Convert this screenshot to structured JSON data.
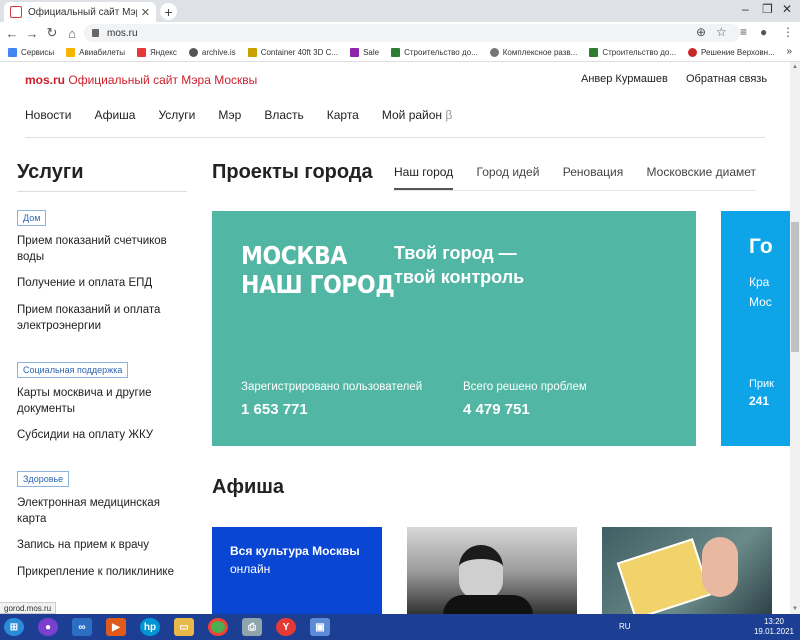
{
  "browser": {
    "tab_title": "Официальный сайт Мэра Моск",
    "tab_close": "✕",
    "new_tab": "+",
    "url": "mos.ru",
    "bookmarks": [
      {
        "label": "Сервисы",
        "color": "#4285f4"
      },
      {
        "label": "Авиабилеты",
        "color": "#f4b400"
      },
      {
        "label": "Яндекс",
        "color": "#e53935"
      },
      {
        "label": "archive.is",
        "color": "#555555"
      },
      {
        "label": "Container 40ft 3D C...",
        "color": "#c8a000"
      },
      {
        "label": "Sale",
        "color": "#8e24aa"
      },
      {
        "label": "Строительство до...",
        "color": "#2e7d32"
      },
      {
        "label": "Комплексное разв...",
        "color": "#757575"
      },
      {
        "label": "Строительство до...",
        "color": "#2e7d32"
      },
      {
        "label": "Решение Верховн...",
        "color": "#c62828"
      }
    ],
    "status_text": "gorod.mos.ru"
  },
  "site": {
    "logo_brand": "mos.ru",
    "logo_text": "Официальный сайт Мэра Москвы",
    "user_name": "Анвер Курмашев",
    "feedback": "Обратная связь",
    "nav": [
      "Новости",
      "Афиша",
      "Услуги",
      "Мэр",
      "Власть",
      "Карта",
      "Мой район"
    ],
    "nav_beta": "β"
  },
  "sidebar": {
    "title": "Услуги",
    "groups": [
      {
        "tag": "Дом",
        "links": [
          "Прием показаний счетчиков воды",
          "Получение и оплата ЕПД",
          "Прием показаний и оплата электроэнергии"
        ]
      },
      {
        "tag": "Социальная поддержка",
        "links": [
          "Карты москвича и другие документы",
          "Субсидии на оплату ЖКУ"
        ]
      },
      {
        "tag": "Здоровье",
        "links": [
          "Электронная медицинская карта",
          "Запись на прием к врачу",
          "Прикрепление к поликлинике"
        ]
      }
    ]
  },
  "projects": {
    "title": "Проекты города",
    "tabs": [
      "Наш город",
      "Город идей",
      "Реновация",
      "Московские диаметры"
    ],
    "banner": {
      "big_line1": "МОСКВА",
      "big_line2": "НАШ ГОРОД",
      "slogan_line1": "Твой город —",
      "slogan_line2": "твой контроль",
      "stat1_label": "Зарегистрировано пользователей",
      "stat1_value": "1 653 771",
      "stat2_label": "Всего решено проблем",
      "stat2_value": "4 479 751"
    },
    "banner2": {
      "title": "Го",
      "line1": "Кра",
      "line2": "Мос",
      "stat_label": "Прик",
      "stat_value": "241"
    }
  },
  "afisha": {
    "title": "Афиша",
    "card1_title": "Вся культура Москвы",
    "card1_sub": "онлайн"
  },
  "taskbar": {
    "lang": "RU",
    "time": "13:20",
    "date": "19.01.2021"
  },
  "colors": {
    "brand_red": "#cc1f2a",
    "banner_teal": "#52b6a4",
    "banner_blue": "#0ea5e8",
    "card_blue": "#0a46d4",
    "taskbar": "#1c3f94"
  }
}
